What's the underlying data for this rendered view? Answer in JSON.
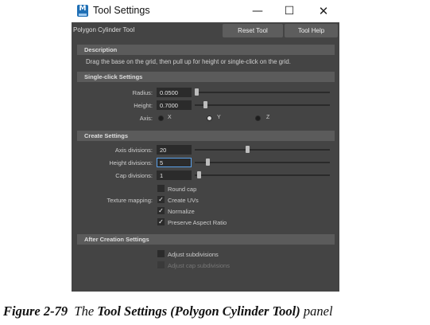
{
  "window": {
    "title": "Tool Settings",
    "icon_label": "M",
    "controls": {
      "minimize": "—",
      "maximize": "☐",
      "close": "✕"
    }
  },
  "header": {
    "tool_name": "Polygon Cylinder Tool",
    "reset_label": "Reset Tool",
    "help_label": "Tool Help"
  },
  "description": {
    "heading": "Description",
    "text": "Drag the base on the grid, then pull up for height or single-click on the grid."
  },
  "single_click": {
    "heading": "Single-click Settings",
    "radius_label": "Radius:",
    "radius_value": "0.0500",
    "height_label": "Height:",
    "height_value": "0.7000",
    "axis_label": "Axis:",
    "axis_options": [
      "X",
      "Y",
      "Z"
    ],
    "axis_selected": "Y"
  },
  "create": {
    "heading": "Create Settings",
    "axis_div_label": "Axis divisions:",
    "axis_div_value": "20",
    "height_div_label": "Height divisions:",
    "height_div_value": "5",
    "cap_div_label": "Cap divisions:",
    "cap_div_value": "1",
    "round_cap_label": "Round cap",
    "texture_label": "Texture mapping:",
    "create_uvs_label": "Create UVs",
    "normalize_label": "Normalize",
    "preserve_label": "Preserve Aspect Ratio",
    "check_glyph": "✓"
  },
  "after": {
    "heading": "After Creation Settings",
    "adjust_sub_label": "Adjust subdivisions",
    "adjust_cap_label": "Adjust cap subdivisions"
  },
  "caption": {
    "figure": "Figure 2-79",
    "the": "The",
    "panel_name": "Tool Settings",
    "tool_name": "(Polygon Cylinder Tool)",
    "panel": "panel"
  }
}
